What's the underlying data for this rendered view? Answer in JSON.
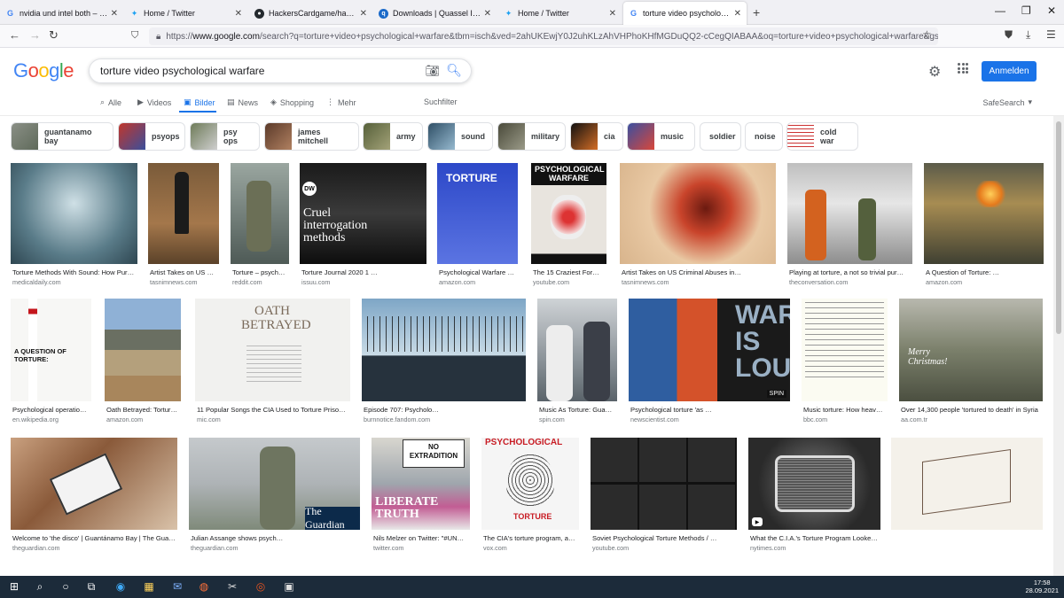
{
  "browser": {
    "tabs": [
      {
        "title": "nvidia und intel both – Google S",
        "favicon": "google-icon",
        "color": "#4285f4"
      },
      {
        "title": "Home / Twitter",
        "favicon": "twitter-icon",
        "color": "#1da1f2"
      },
      {
        "title": "HackersCardgame/hackerscard",
        "favicon": "github-icon",
        "color": "#24292e"
      },
      {
        "title": "Downloads | Quassel IRC",
        "favicon": "quassel-icon",
        "color": "#1b6ac9"
      },
      {
        "title": "Home / Twitter",
        "favicon": "twitter-icon",
        "color": "#1da1f2"
      },
      {
        "title": "torture video psychological warfa",
        "favicon": "google-icon",
        "color": "#4285f4"
      }
    ],
    "url_scheme": "https://",
    "url_host": "www.google.com",
    "url_path": "/search?q=torture+video+psychological+warfare&tbm=isch&ved=2ahUKEwjY0J2uhKLzAhVHPhoKHfMGDuQQ2-cCegQIABAA&oq=torture+video+psychological+warfare&gs_lcp=CgNpbWcQAzoG"
  },
  "google": {
    "logo_letters": [
      "G",
      "o",
      "o",
      "g",
      "l",
      "e"
    ],
    "logo_colors": [
      "#4285f4",
      "#ea4335",
      "#fbbc05",
      "#4285f4",
      "#34a853",
      "#ea4335"
    ],
    "query": "torture video psychological warfare",
    "login_label": "Anmelden",
    "menu": {
      "all": "Alle",
      "videos": "Videos",
      "images": "Bilder",
      "news": "News",
      "shopping": "Shopping",
      "more": "Mehr",
      "filter": "Suchfilter",
      "safesearch": "SafeSearch"
    },
    "chips": [
      "guantanamo bay",
      "psyops",
      "psy ops",
      "james mitchell",
      "army",
      "sound",
      "military",
      "cia",
      "music",
      "soldier",
      "noise",
      "cold war"
    ],
    "results": [
      {
        "caption": "Torture Methods With Sound: How Pur…",
        "domain": "medicaldaily.com"
      },
      {
        "caption": "Artist Takes on US Criminal Abuses in Iraq …",
        "domain": "tasnimnews.com"
      },
      {
        "caption": "Torture – psychological interrogation …",
        "domain": "reddit.com"
      },
      {
        "caption": "Torture Journal 2020 1 …",
        "domain": "issuu.com"
      },
      {
        "caption": "Psychological Warfare …",
        "domain": "amazon.com"
      },
      {
        "caption": "The 15 Craziest Forms of Psychological Torture…",
        "domain": "youtube.com"
      },
      {
        "caption": "Artist Takes on US Criminal Abuses in…",
        "domain": "tasnimnews.com"
      },
      {
        "caption": "Playing at torture, a not so trivial pur…",
        "domain": "theconversation.com"
      },
      {
        "caption": "A Question of Torture: …",
        "domain": "amazon.com"
      },
      {
        "caption": "Psychological operatio…",
        "domain": "en.wikipedia.org"
      },
      {
        "caption": "Oath Betrayed: Torture, Medical Complicity, and …",
        "domain": "amazon.com"
      },
      {
        "caption": "11 Popular Songs the CIA Used to Torture Prisoner…",
        "domain": "mic.com"
      },
      {
        "caption": "Episode 707: Psycholo…",
        "domain": "burnnotice.fandom.com"
      },
      {
        "caption": "Music As Torture: Guantanamo Bay Feature - Mus…",
        "domain": "spin.com"
      },
      {
        "caption": "Psychological torture 'as …",
        "domain": "newscientist.com"
      },
      {
        "caption": "Music torture: How heavy metal broke Manu…",
        "domain": "bbc.com"
      },
      {
        "caption": "Over 14,300 people 'tortured to death' in Syria",
        "domain": "aa.com.tr"
      },
      {
        "caption": "Welcome to 'the disco' | Guantánamo Bay | The Guard…",
        "domain": "theguardian.com"
      },
      {
        "caption": "Julian Assange shows psych…",
        "domain": "theguardian.com"
      },
      {
        "caption": "Nils Melzer on Twitter: \"#UN…",
        "domain": "twitter.com"
      },
      {
        "caption": "The CIA's torture program, as explained by th…",
        "domain": "vox.com"
      },
      {
        "caption": "Soviet Psychological Torture Methods / …",
        "domain": "youtube.com"
      },
      {
        "caption": "What the C.I.A.'s Torture Program Looked Like t…",
        "domain": "nytimes.com"
      }
    ],
    "image_texts": {
      "cruel": "Cruel interrogation methods",
      "dw": "DW",
      "torture_journal": "TORTURE",
      "psych_warfare": "PSYCHOLOGICAL WARFARE",
      "question_torture": "A QUESTION OF TORTURE:",
      "oath": "OATH BETRAYED",
      "war_is_loud": "WAR IS LOUD",
      "spin_badge": "SPIN",
      "merry": "Merry Christmas!",
      "guardian": "The Guardian",
      "no_extradition": "NO EXTRADITION",
      "liberate": "LIBERATE TRUTH",
      "psych_top": "PSYCHOLOGICAL",
      "torture_bottom": "TORTURE"
    }
  },
  "taskbar": {
    "time": "17:58",
    "date": "28.09.2021"
  }
}
